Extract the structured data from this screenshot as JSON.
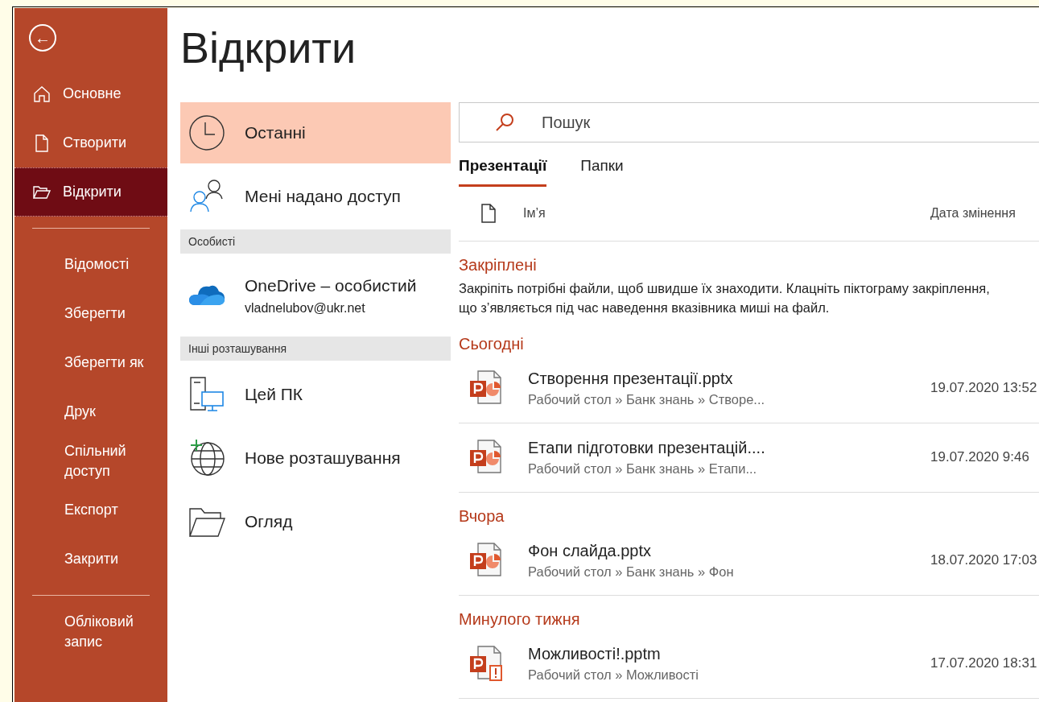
{
  "sidebar": {
    "back_label": "←",
    "groups": [
      [
        {
          "label": "Основне",
          "selected": false
        },
        {
          "label": "Створити",
          "selected": false
        },
        {
          "label": "Відкрити",
          "selected": true
        }
      ],
      [
        {
          "label": "Відомості",
          "selected": false
        },
        {
          "label": "Зберегти",
          "selected": false
        },
        {
          "label": "Зберегти як",
          "selected": false
        },
        {
          "label": "Друк",
          "selected": false
        },
        {
          "label": "Спільний доступ",
          "selected": false
        },
        {
          "label": "Експорт",
          "selected": false
        },
        {
          "label": "Закрити",
          "selected": false
        }
      ],
      [
        {
          "label": "Обліковий запис",
          "selected": false
        }
      ]
    ]
  },
  "title": "Відкрити",
  "places": [
    {
      "kind": "place",
      "label": "Останні",
      "selected": true
    },
    {
      "kind": "place",
      "label": "Мені надано доступ",
      "selected": false
    },
    {
      "kind": "header",
      "label": "Особисті"
    },
    {
      "kind": "account",
      "label": "OneDrive – особистий",
      "sublabel": "vladnelubov@ukr.net",
      "selected": false
    },
    {
      "kind": "header",
      "label": "Інші розташування"
    },
    {
      "kind": "place",
      "label": "Цей ПК",
      "selected": false
    },
    {
      "kind": "place",
      "label": "Нове розташування",
      "selected": false
    },
    {
      "kind": "place",
      "label": "Огляд",
      "selected": false
    }
  ],
  "search": {
    "placeholder": "Пошук"
  },
  "tabs": [
    {
      "label": "Презентації",
      "selected": true
    },
    {
      "label": "Папки",
      "selected": false
    }
  ],
  "columns": [
    "Ім’я",
    "Дата змінення"
  ],
  "sections": [
    {
      "title": "Закріплені",
      "note": "Закріпіть потрібні файли, щоб швидше їх знаходити. Клацніть піктограму закріплення, що з’являється під час наведення вказівника миші на файл."
    },
    {
      "title": "Сьогодні",
      "files": [
        {
          "kind": "pptx",
          "name": "Створення презентації.pptx",
          "path": "Рабочий стол » Банк знань » Створе...",
          "date": "19.07.2020 13:52"
        },
        {
          "kind": "pptx",
          "name": "Етапи підготовки презентацій....",
          "path": "Рабочий стол » Банк знань » Етапи...",
          "date": "19.07.2020 9:46"
        }
      ]
    },
    {
      "title": "Вчора",
      "files": [
        {
          "kind": "pptx",
          "name": "Фон слайда.pptx",
          "path": "Рабочий стол » Банк знань » Фон",
          "date": "18.07.2020 17:03"
        }
      ]
    },
    {
      "title": "Минулого тижня",
      "files": [
        {
          "kind": "pptm",
          "name": "Можливості!.pptm",
          "path": "Рабочий стол » Можливості",
          "date": "17.07.2020 18:31"
        }
      ]
    }
  ]
}
